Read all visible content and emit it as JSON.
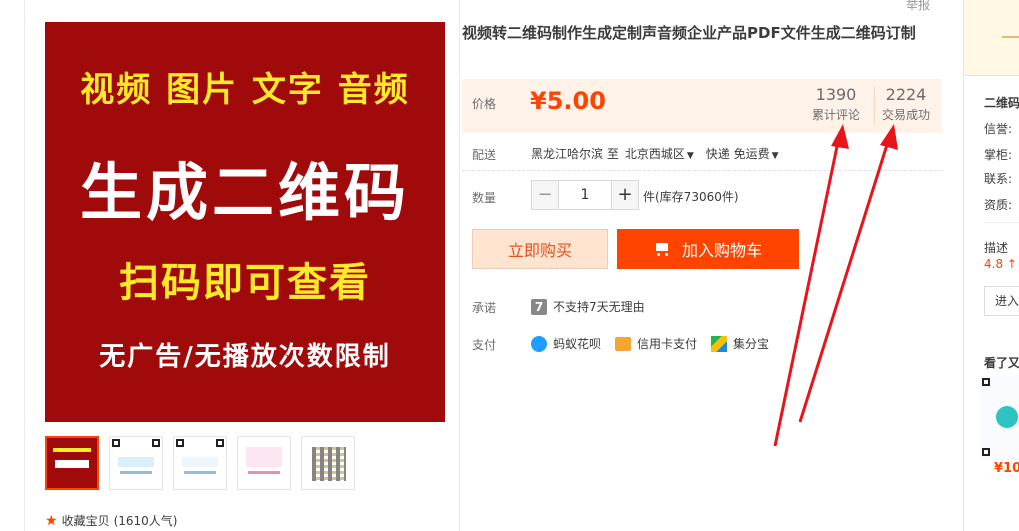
{
  "report_link": "举报",
  "product": {
    "title": "视频转二维码制作生成定制声音频企业产品PDF文件生成二维码订制",
    "main_image": {
      "line1": "视频 图片 文字 音频",
      "line2": "生成二维码",
      "line3": "扫码即可查看",
      "line4": "无广告/无播放次数限制"
    },
    "favorite": {
      "label": "收藏宝贝",
      "count": "(1610人气)"
    }
  },
  "price": {
    "label": "价格",
    "value": "¥5.00",
    "reviews": {
      "count": "1390",
      "label": "累计评论"
    },
    "deals": {
      "count": "2224",
      "label": "交易成功"
    }
  },
  "shipping": {
    "label": "配送",
    "from": "黑龙江哈尔滨 至",
    "to": "北京西城区",
    "method": "快递 免运费"
  },
  "quantity": {
    "label": "数量",
    "minus": "−",
    "value": "1",
    "plus": "+",
    "stock": "件(库存73060件)"
  },
  "actions": {
    "buy_now": "立即购买",
    "add_to_cart": "加入购物车"
  },
  "promise": {
    "label": "承诺",
    "icon_text": "7",
    "text": "不支持7天无理由"
  },
  "payment": {
    "label": "支付",
    "methods": [
      "蚂蚁花呗",
      "信用卡支付",
      "集分宝"
    ]
  },
  "shop": {
    "name": "二维码",
    "fields": [
      "信誉:",
      "掌柜:",
      "联系:",
      "资质:"
    ],
    "desc_label": "描述",
    "desc_score": "4.8 ↑",
    "enter": "进入",
    "seen_title": "看了又",
    "seen_price": "¥10"
  },
  "colors": {
    "accent": "#ff4400",
    "price_bg": "#fff2e8",
    "main_image_bg": "#a10a0a",
    "main_image_yellow": "#ffe92b"
  }
}
